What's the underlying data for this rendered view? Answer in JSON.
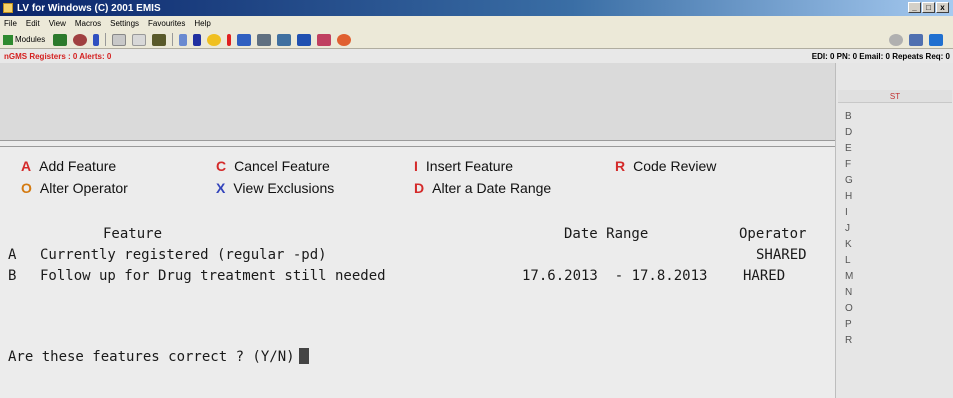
{
  "window": {
    "title": "LV for Windows (C) 2001 EMIS"
  },
  "menu": [
    "File",
    "Edit",
    "View",
    "Macros",
    "Settings",
    "Favourites",
    "Help"
  ],
  "toolbar": {
    "modules_label": "Modules"
  },
  "status": {
    "left": "nGMS Registers : 0  Alerts: 0",
    "right": "EDI: 0  PN: 0  Email: 0  Repeats Req: 0"
  },
  "commands": [
    {
      "key": "A",
      "label": "Add Feature",
      "color": "#d42a2a"
    },
    {
      "key": "C",
      "label": "Cancel Feature",
      "color": "#d42a2a"
    },
    {
      "key": "I",
      "label": "Insert Feature",
      "color": "#d42a2a"
    },
    {
      "key": "R",
      "label": "Code Review",
      "color": "#d42a2a"
    },
    {
      "key": "O",
      "label": "Alter Operator",
      "color": "#d47a10"
    },
    {
      "key": "X",
      "label": "View Exclusions",
      "color": "#3344bb"
    },
    {
      "key": "D",
      "label": "Alter a Date Range",
      "color": "#d42a2a"
    }
  ],
  "table": {
    "headers": {
      "feature": "Feature",
      "date_range": "Date Range",
      "operator": "Operator"
    },
    "rows": [
      {
        "key": "A",
        "feature": "Currently registered (regular -pd)",
        "date_range": "",
        "operator": "SHARED"
      },
      {
        "key": "B",
        "feature": "Follow up for Drug treatment still needed",
        "date_range": "17.6.2013  - 17.8.2013",
        "operator": "HARED"
      }
    ]
  },
  "prompt": "Are these features correct ? (Y/N)",
  "side_panel": {
    "header": "ST",
    "letters": [
      "B",
      "D",
      "E",
      "F",
      "G",
      "H",
      "I",
      "J",
      "K",
      "L",
      "M",
      "N",
      "O",
      "P",
      "R"
    ]
  }
}
